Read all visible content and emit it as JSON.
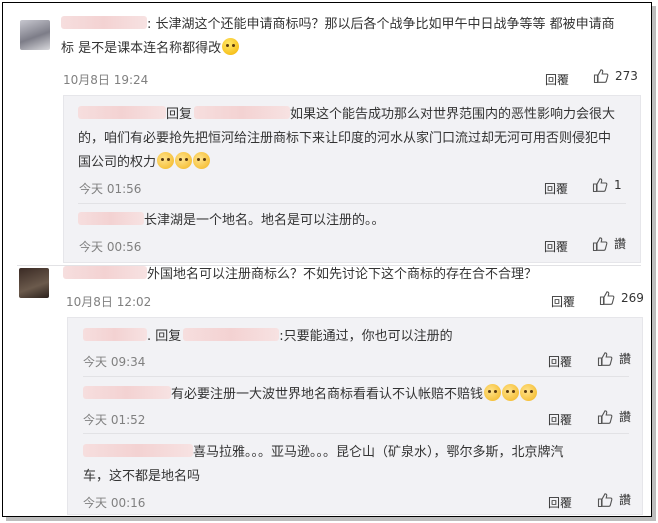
{
  "comments": [
    {
      "user_blurred": true,
      "text_line1": ": 长津湖这个还能申请商标吗？那以后各个战争比如甲午中日战争等等 都被申请商",
      "text_line2": "标 是不是课本连名称都得改",
      "time": "10月8日 19:24",
      "reply_label": "回覆",
      "likes": "273",
      "replies": [
        {
          "reply_prefix": "回复",
          "text_line1": "如果这个能告成功那么对世界范围内的恶性影响力会很大",
          "text_line2": "的，咱们有必要抢先把恒河给注册商标下来让印度的河水从家门口流过却无河可用否则侵犯中",
          "text_line3": "国公司的权力",
          "time": "今天 01:56",
          "reply_label": "回覆",
          "likes": "1"
        },
        {
          "text_line1": "长津湖是一个地名。地名是可以注册的。。",
          "time": "今天 00:56",
          "reply_label": "回覆",
          "likes": "讚"
        }
      ]
    },
    {
      "user_blurred": true,
      "text_line1": "外国地名可以注册商标么？不如先讨论下这个商标的存在合不合理？",
      "time": "10月8日 12:02",
      "reply_label": "回覆",
      "likes": "269",
      "replies": [
        {
          "reply_prefix": ". 回复",
          "text_line1": ":只要能通过，你也可以注册的",
          "time": "今天 09:34",
          "reply_label": "回覆",
          "likes": "讚"
        },
        {
          "text_line1": "有必要注册一大波世界地名商标看看认不认帐赔不赔钱",
          "time": "今天 01:52",
          "reply_label": "回覆",
          "likes": "讚"
        },
        {
          "text_line1": "喜马拉雅。。。亚马逊。。。昆仑山（矿泉水），鄂尔多斯，北京牌汽",
          "text_line2": "车，这不都是地名吗",
          "time": "今天 00:16",
          "reply_label": "回覆",
          "likes": "讚"
        }
      ]
    }
  ],
  "icons": {
    "like": "thumbs-up-icon",
    "emoji_smile": "smile-emoji-icon",
    "emoji_cat": "cat-emoji-icon"
  }
}
